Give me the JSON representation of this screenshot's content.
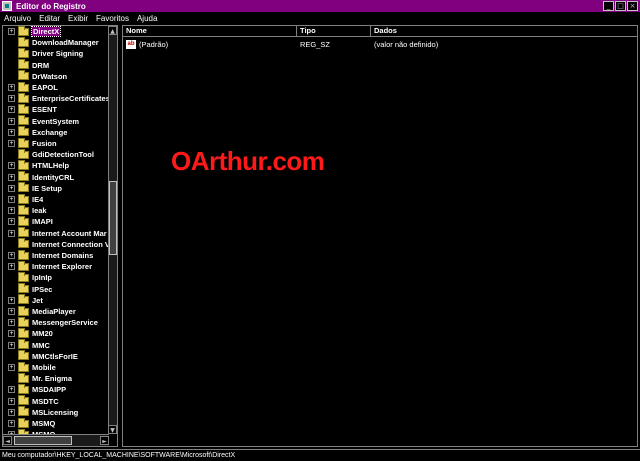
{
  "window": {
    "title": "Editor do Registro"
  },
  "menu": [
    "Arquivo",
    "Editar",
    "Exibir",
    "Favoritos",
    "Ajuda"
  ],
  "tree": {
    "items": [
      {
        "label": "DirectX",
        "expander": "+",
        "selected": true
      },
      {
        "label": "DownloadManager",
        "expander": ""
      },
      {
        "label": "Driver Signing",
        "expander": ""
      },
      {
        "label": "DRM",
        "expander": ""
      },
      {
        "label": "DrWatson",
        "expander": ""
      },
      {
        "label": "EAPOL",
        "expander": "+"
      },
      {
        "label": "EnterpriseCertificates",
        "expander": "+"
      },
      {
        "label": "ESENT",
        "expander": "+"
      },
      {
        "label": "EventSystem",
        "expander": "+"
      },
      {
        "label": "Exchange",
        "expander": "+"
      },
      {
        "label": "Fusion",
        "expander": "+"
      },
      {
        "label": "GdiDetectionTool",
        "expander": ""
      },
      {
        "label": "HTMLHelp",
        "expander": "+"
      },
      {
        "label": "IdentityCRL",
        "expander": "+"
      },
      {
        "label": "IE Setup",
        "expander": "+"
      },
      {
        "label": "IE4",
        "expander": "+"
      },
      {
        "label": "Ieak",
        "expander": "+"
      },
      {
        "label": "IMAPI",
        "expander": "+"
      },
      {
        "label": "Internet Account Mar",
        "expander": "+"
      },
      {
        "label": "Internet Connection V",
        "expander": ""
      },
      {
        "label": "Internet Domains",
        "expander": "+"
      },
      {
        "label": "Internet Explorer",
        "expander": "+"
      },
      {
        "label": "IpInIp",
        "expander": ""
      },
      {
        "label": "IPSec",
        "expander": ""
      },
      {
        "label": "Jet",
        "expander": "+"
      },
      {
        "label": "MediaPlayer",
        "expander": "+"
      },
      {
        "label": "MessengerService",
        "expander": "+"
      },
      {
        "label": "MM20",
        "expander": "+"
      },
      {
        "label": "MMC",
        "expander": "+"
      },
      {
        "label": "MMCtlsForIE",
        "expander": ""
      },
      {
        "label": "Mobile",
        "expander": "+"
      },
      {
        "label": "Mr. Enigma",
        "expander": ""
      },
      {
        "label": "MSDAIPP",
        "expander": "+"
      },
      {
        "label": "MSDTC",
        "expander": "+"
      },
      {
        "label": "MSLicensing",
        "expander": "+"
      },
      {
        "label": "MSMQ",
        "expander": "+"
      },
      {
        "label": "MSMQ",
        "expander": "+"
      }
    ]
  },
  "values_list": {
    "columns": [
      "Nome",
      "Tipo",
      "Dados"
    ],
    "rows": [
      {
        "name": "(Padrão)",
        "type": "REG_SZ",
        "data": "(valor não definido)",
        "icon": "ab-string-icon"
      }
    ]
  },
  "watermark": "OArthur.com",
  "status": "Meu computador\\HKEY_LOCAL_MACHINE\\SOFTWARE\\Microsoft\\DirectX",
  "colors": {
    "titlebar": "#800080",
    "background": "#000000",
    "watermark": "#ff1a1a",
    "folder": "#e8d25a"
  }
}
